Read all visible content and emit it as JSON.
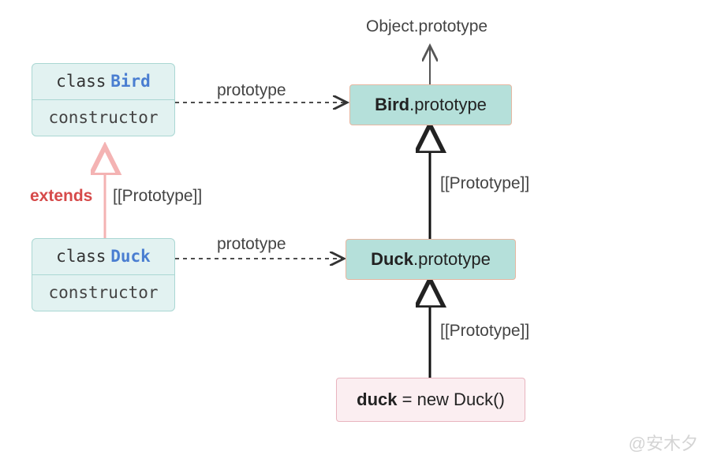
{
  "top_label": "Object.prototype",
  "bird_class": {
    "keyword": "class",
    "name": "Bird",
    "member": "constructor"
  },
  "duck_class": {
    "keyword": "class",
    "name": "Duck",
    "member": "constructor"
  },
  "bird_proto": {
    "bold": "Bird",
    "rest": ".prototype"
  },
  "duck_proto": {
    "bold": "Duck",
    "rest": ".prototype"
  },
  "instance": {
    "bold": "duck",
    "rest": " = new Duck()"
  },
  "labels": {
    "extends": "extends",
    "proto_bracket": "[[Prototype]]",
    "prototype": "prototype"
  },
  "watermark": "@安木夕"
}
